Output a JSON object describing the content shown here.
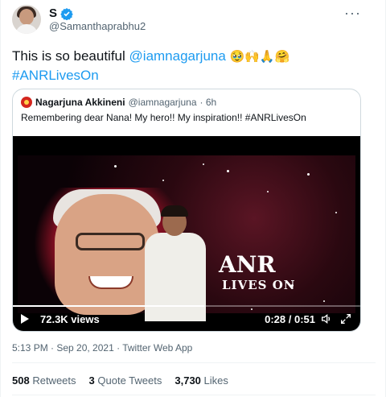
{
  "author": {
    "display_name": "S",
    "handle": "@Samanthaprabhu2",
    "verified": true
  },
  "tweet": {
    "text_lead": "This is so beautiful",
    "mention": "@iamnagarjuna",
    "emojis": "🥹🙌🙏🤗",
    "hashtag": "#ANRLivesOn",
    "more_label": "···"
  },
  "quoted": {
    "display_name": "Nagarjuna Akkineni",
    "handle": "@iamnagarjuna",
    "time": "· 6h",
    "text": "Remembering dear Nana! My hero!! My inspiration!! #ANRLivesOn",
    "video": {
      "overlay_title": "ANR",
      "overlay_subtitle": "LIVES ON",
      "views": "72.3K views",
      "time": "0:28 / 0:51",
      "progress_fraction": 0.55
    }
  },
  "meta": {
    "timestamp": "5:13 PM · Sep 20, 2021 · Twitter Web App"
  },
  "stats": {
    "retweets_count": "508",
    "retweets_label": "Retweets",
    "quotes_count": "3",
    "quotes_label": "Quote Tweets",
    "likes_count": "3,730",
    "likes_label": "Likes"
  },
  "colors": {
    "accent": "#1d9bf0",
    "secondary_text": "#536471",
    "border": "#cfd9de"
  }
}
